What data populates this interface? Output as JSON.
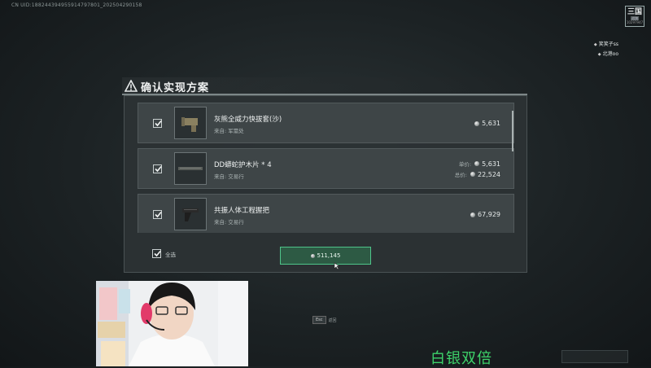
{
  "uid_text": "CN UID:18824439495591479780​1_202504290158",
  "logo": {
    "line1": "三国",
    "line2": "战旗",
    "line3": "10297947"
  },
  "players": [
    {
      "name": "笑笑子ss"
    },
    {
      "name": "北港oo"
    }
  ],
  "dialog": {
    "title": "确认实现方案",
    "items": [
      {
        "name": "灰熊全威力快拔套(沙)",
        "source": "来自:  军需处",
        "price": "5,631",
        "checked": true
      },
      {
        "name": "DD蟒蛇护木片 * 4",
        "source": "来自:  交易行",
        "unit_label": "单价:",
        "unit_price": "5,631",
        "total_label": "总价:",
        "total_price": "22,524",
        "checked": true
      },
      {
        "name": "共振人体工程握把",
        "source": "来自:  交易行",
        "price": "67,929",
        "checked": true
      }
    ],
    "select_all_label": "全选",
    "confirm_total": "511,145"
  },
  "esc_hint": {
    "key": "Esc",
    "label": "返回"
  },
  "overlay_text": "白银双倍",
  "colors": {
    "accent_green": "#4fc48a",
    "overlay_green": "#3dd26a"
  }
}
